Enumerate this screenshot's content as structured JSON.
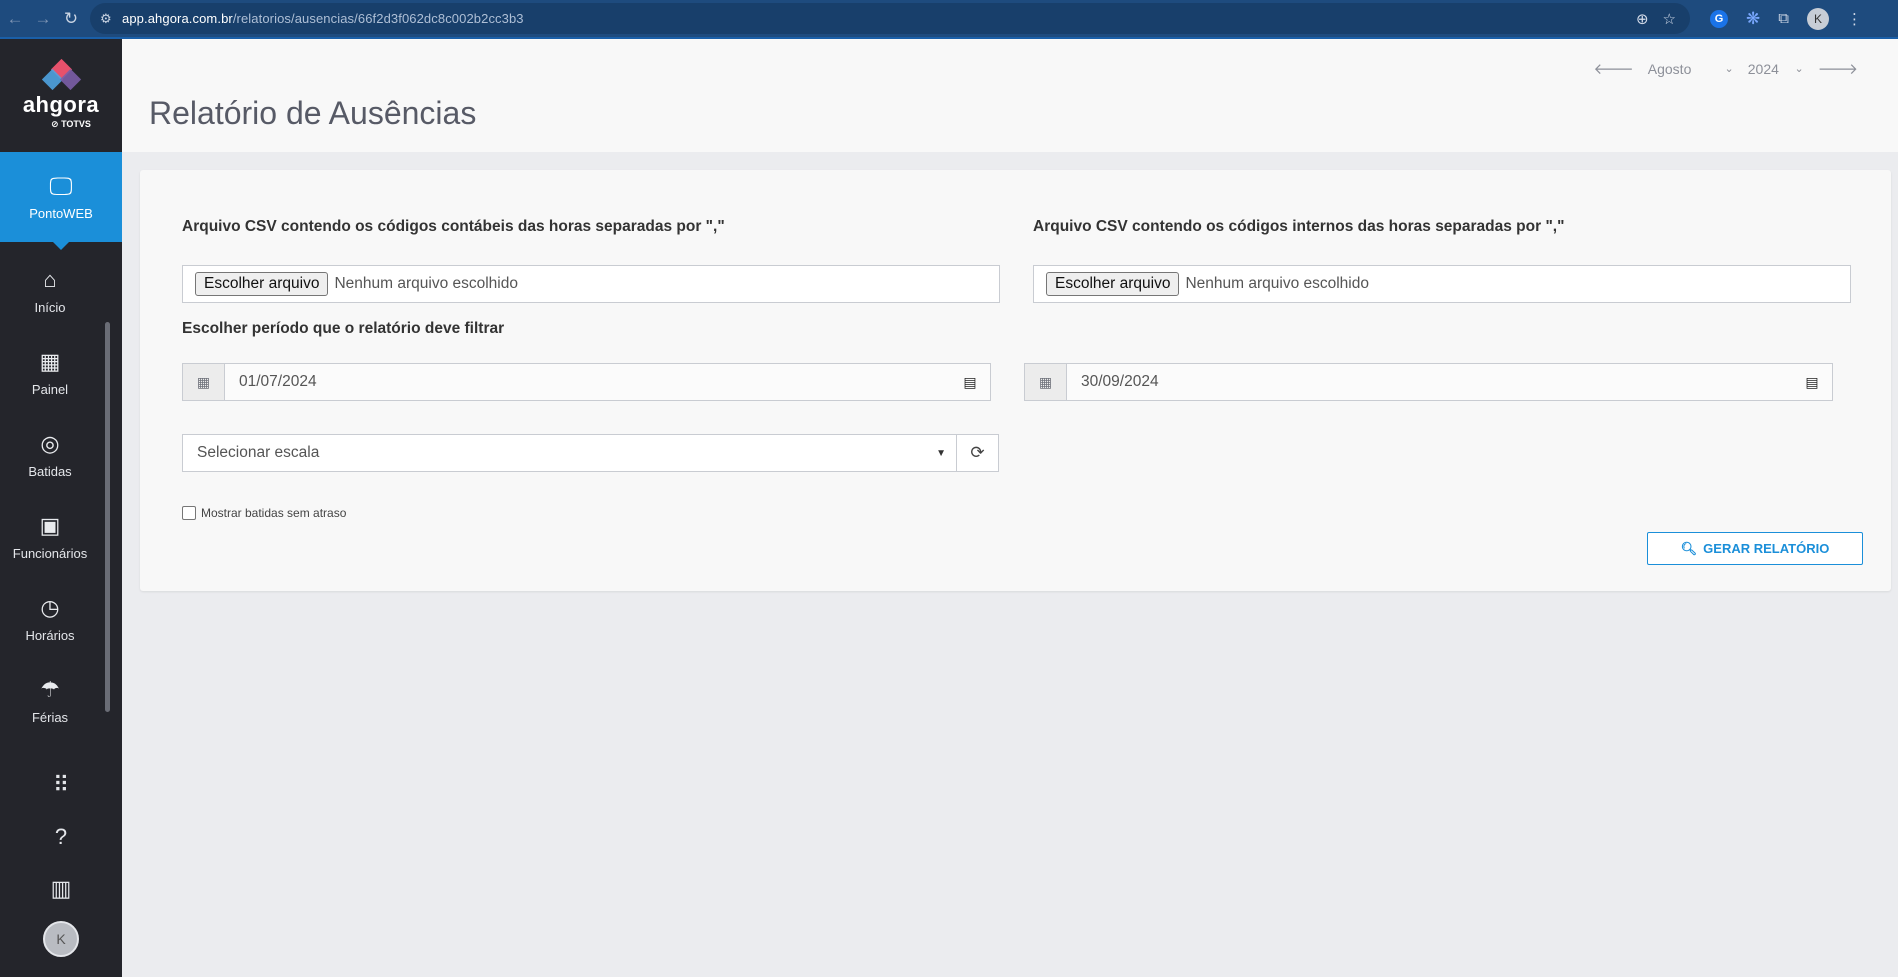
{
  "browser": {
    "url_host": "app.ahgora.com.br",
    "url_path": "/relatorios/ausencias/66f2d3f062dc8c002b2cc3b3",
    "profile_initial": "K"
  },
  "sidebar": {
    "logo_text": "ahgora",
    "logo_sub": "TOTVS",
    "active": {
      "label": "PontoWEB",
      "icon": "monitor-icon"
    },
    "items": [
      {
        "label": "Início",
        "icon": "home-icon"
      },
      {
        "label": "Painel",
        "icon": "dashboard-icon"
      },
      {
        "label": "Batidas",
        "icon": "fingerprint-icon"
      },
      {
        "label": "Funcionários",
        "icon": "badge-icon"
      },
      {
        "label": "Horários",
        "icon": "clock-icon"
      },
      {
        "label": "Férias",
        "icon": "beach-umbrella-icon"
      }
    ],
    "bottom": [
      "apps-grid-icon",
      "help-icon",
      "building-icon"
    ],
    "avatar_initial": "K"
  },
  "header": {
    "title": "Relatório de Ausências",
    "month": "Agosto",
    "year": "2024"
  },
  "form": {
    "csv_contabeis_label": "Arquivo CSV contendo os códigos contábeis das horas separadas por \",\"",
    "csv_internos_label": "Arquivo CSV contendo os códigos internos das horas separadas por \",\"",
    "file_button": "Escolher arquivo",
    "file_none": "Nenhum arquivo escolhido",
    "period_label": "Escolher período que o relatório deve filtrar",
    "date_start": "01/07/2024",
    "date_end": "30/09/2024",
    "escala_placeholder": "Selecionar escala",
    "checkbox_label": "Mostrar batidas sem atraso",
    "generate_button": "GERAR RELATÓRIO"
  },
  "colors": {
    "accent": "#1b8fd9",
    "sidebar": "#24252b",
    "browser": "#1e4b7e"
  }
}
